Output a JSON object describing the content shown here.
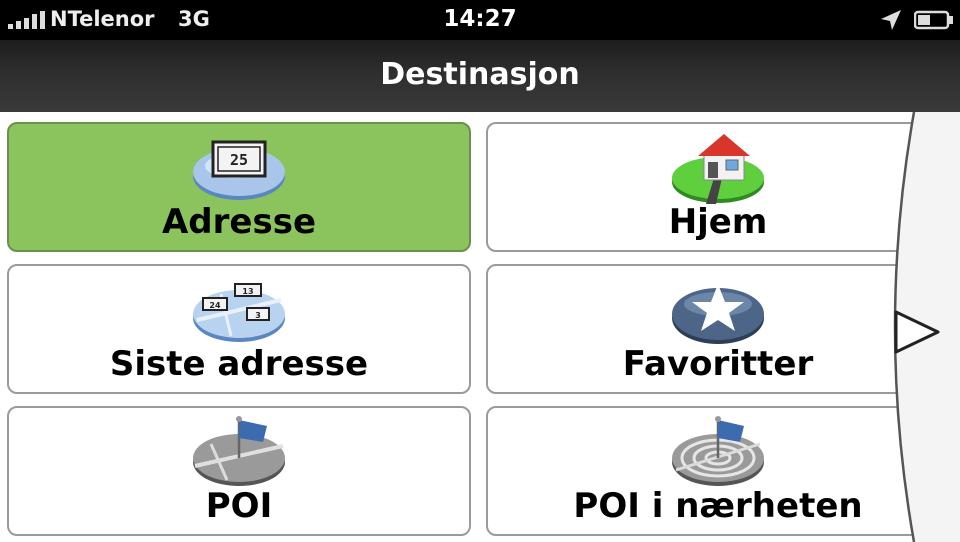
{
  "status_bar": {
    "carrier": "NTelenor",
    "network": "3G",
    "time": "14:27",
    "icons": [
      "signal-bars-icon",
      "location-arrow-icon",
      "battery-icon"
    ]
  },
  "header": {
    "title": "Destinasjon"
  },
  "menu": {
    "items": [
      {
        "label": "Adresse",
        "icon": "address-sign-icon",
        "selected": true
      },
      {
        "label": "Hjem",
        "icon": "home-icon",
        "selected": false
      },
      {
        "label": "Siste adresse",
        "icon": "recent-addresses-icon",
        "selected": false
      },
      {
        "label": "Favoritter",
        "icon": "star-icon",
        "selected": false
      },
      {
        "label": "POI",
        "icon": "poi-flag-icon",
        "selected": false
      },
      {
        "label": "POI i nærheten",
        "icon": "nearby-poi-icon",
        "selected": false
      }
    ],
    "address_sign_number": "25",
    "recent_sign_numbers": [
      "13",
      "24",
      "3"
    ]
  },
  "navigation": {
    "next_icon": "next-page-arrow-icon"
  },
  "colors": {
    "selected": "#8bc35c",
    "header_bg": "#2e2e2e",
    "status_bg": "#000000"
  }
}
